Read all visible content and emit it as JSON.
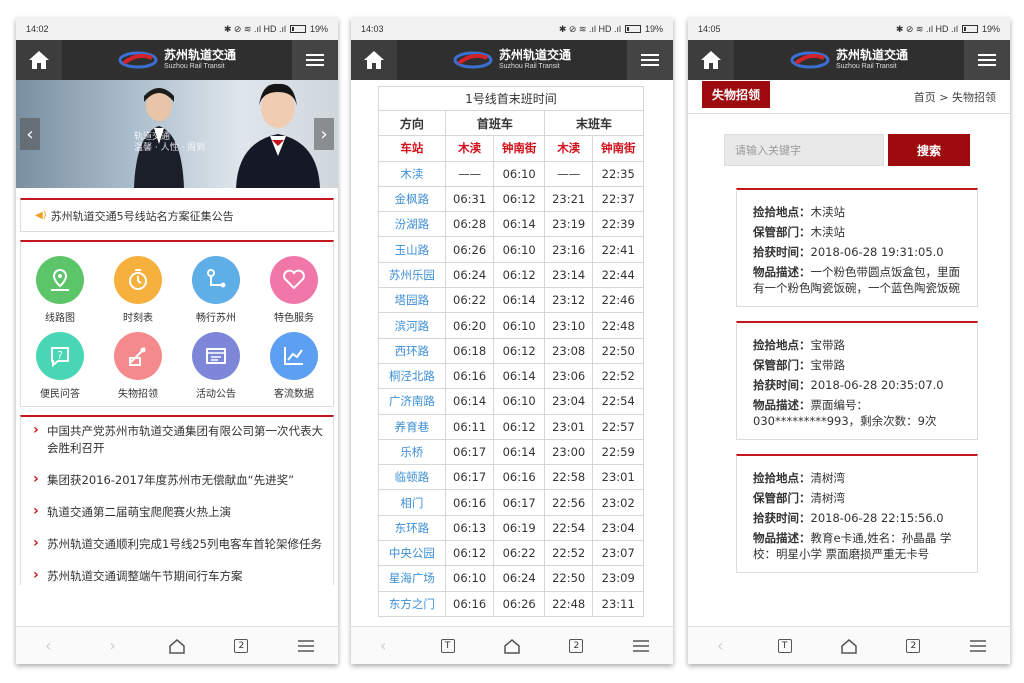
{
  "common": {
    "brand_cn": "苏州轨道交通",
    "brand_en": "Suzhou Rail Transit",
    "status_icons": "✱ ⊘ ≋ .ıl HD .ıl",
    "battery": "19%",
    "tab_count": "2",
    "tab_t": "T",
    "colors": {
      "appbar": "#2f2f2f",
      "accent_red": "#c4161c",
      "station_blue": "#3e8fd6"
    }
  },
  "phone1": {
    "time": "14:02",
    "banner_text": "轨道交通\n温馨 · 人性 · 周到",
    "notice": "苏州轨道交通5号线站名方案征集公告",
    "icons": [
      {
        "label": "线路图",
        "color": "#5cc56a",
        "icon": "map-pin-icon"
      },
      {
        "label": "时刻表",
        "color": "#f5b03d",
        "icon": "stopwatch-icon"
      },
      {
        "label": "畅行苏州",
        "color": "#5eaee8",
        "icon": "route-icon"
      },
      {
        "label": "特色服务",
        "color": "#f277a9",
        "icon": "heart-icon"
      },
      {
        "label": "便民问答",
        "color": "#49d6b4",
        "icon": "question-icon"
      },
      {
        "label": "失物招领",
        "color": "#f48a8c",
        "icon": "lost-found-icon"
      },
      {
        "label": "活动公告",
        "color": "#7d86d9",
        "icon": "announcement-icon"
      },
      {
        "label": "客流数据",
        "color": "#5d9ff0",
        "icon": "chart-icon"
      }
    ],
    "news": [
      "中国共产党苏州市轨道交通集团有限公司第一次代表大会胜利召开",
      "集团获2016-2017年度苏州市无偿献血“先进奖”",
      "轨道交通第二届萌宝爬爬赛火热上演",
      "苏州轨道交通顺利完成1号线25列电客车首轮架修任务",
      "苏州轨道交通调整端午节期间行车方案"
    ]
  },
  "phone2": {
    "time": "14:03",
    "caption": "1号线首末班时间",
    "headers": {
      "direction": "方向",
      "first": "首班车",
      "last": "末班车",
      "station": "车站",
      "mudu": "木渎",
      "zhongnan": "钟南街"
    },
    "rows": [
      [
        "木渎",
        "——",
        "06:10",
        "——",
        "22:35"
      ],
      [
        "金枫路",
        "06:31",
        "06:12",
        "23:21",
        "22:37"
      ],
      [
        "汾湖路",
        "06:28",
        "06:14",
        "23:19",
        "22:39"
      ],
      [
        "玉山路",
        "06:26",
        "06:10",
        "23:16",
        "22:41"
      ],
      [
        "苏州乐园",
        "06:24",
        "06:12",
        "23:14",
        "22:44"
      ],
      [
        "塔园路",
        "06:22",
        "06:14",
        "23:12",
        "22:46"
      ],
      [
        "滨河路",
        "06:20",
        "06:10",
        "23:10",
        "22:48"
      ],
      [
        "西环路",
        "06:18",
        "06:12",
        "23:08",
        "22:50"
      ],
      [
        "桐泾北路",
        "06:16",
        "06:14",
        "23:06",
        "22:52"
      ],
      [
        "广济南路",
        "06:14",
        "06:10",
        "23:04",
        "22:54"
      ],
      [
        "养育巷",
        "06:11",
        "06:12",
        "23:01",
        "22:57"
      ],
      [
        "乐桥",
        "06:17",
        "06:14",
        "23:00",
        "22:59"
      ],
      [
        "临顿路",
        "06:17",
        "06:16",
        "22:58",
        "23:01"
      ],
      [
        "相门",
        "06:16",
        "06:17",
        "22:56",
        "23:02"
      ],
      [
        "东环路",
        "06:13",
        "06:19",
        "22:54",
        "23:04"
      ],
      [
        "中央公园",
        "06:12",
        "06:22",
        "22:52",
        "23:07"
      ],
      [
        "星海广场",
        "06:10",
        "06:24",
        "22:50",
        "23:09"
      ],
      [
        "东方之门",
        "06:16",
        "06:26",
        "22:48",
        "23:11"
      ]
    ]
  },
  "phone3": {
    "time": "14:05",
    "tag": "失物招领",
    "breadcrumb": "首页 > 失物招领",
    "search_placeholder": "请输入关键字",
    "search_button": "搜索",
    "labels": {
      "location": "捡拾地点：",
      "dept": "保管部门：",
      "time": "拾获时间：",
      "desc": "物品描述："
    },
    "cards": [
      {
        "location": "木渎站",
        "dept": "木渎站",
        "time": "2018-06-28 19:31:05.0",
        "desc": "一个粉色带圆点饭盒包，里面有一个粉色陶瓷饭碗，一个蓝色陶瓷饭碗"
      },
      {
        "location": "宝带路",
        "dept": "宝带路",
        "time": "2018-06-28 20:35:07.0",
        "desc": "票面编号：030*********993，剩余次数：9次"
      },
      {
        "location": "清树湾",
        "dept": "清树湾",
        "time": "2018-06-28 22:15:56.0",
        "desc": "教育e卡通,姓名：孙晶晶 学校：明星小学 票面磨损严重无卡号"
      }
    ]
  }
}
